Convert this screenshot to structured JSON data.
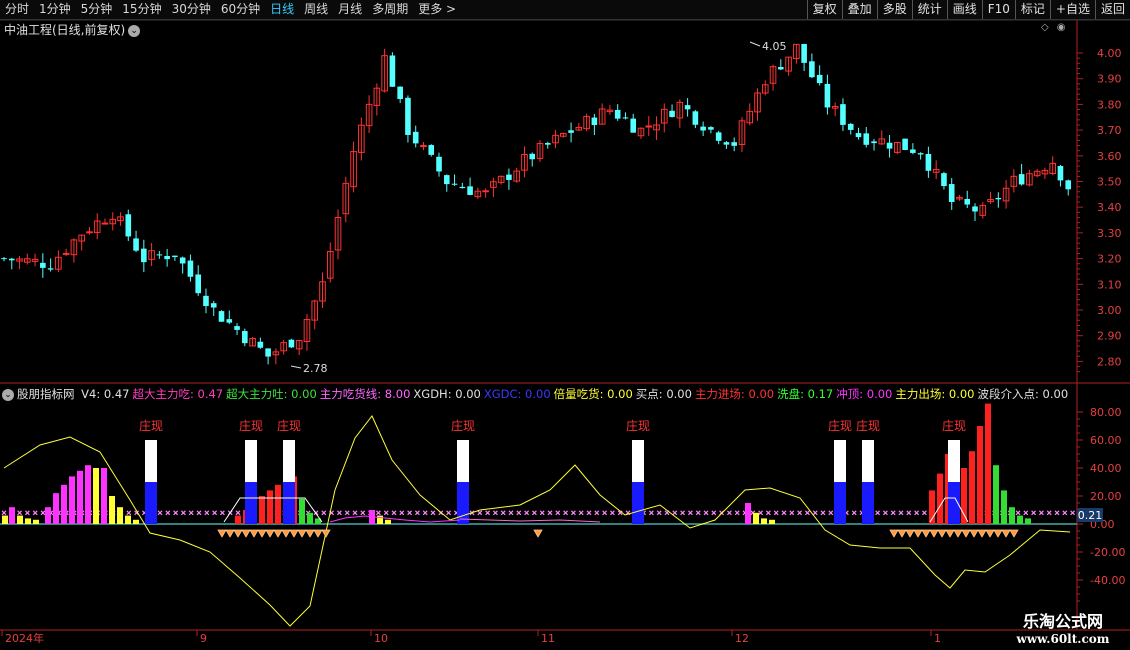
{
  "topbar": {
    "periods": [
      "分时",
      "1分钟",
      "5分钟",
      "15分钟",
      "30分钟",
      "60分钟",
      "日线",
      "周线",
      "月线",
      "多周期"
    ],
    "active_period": "日线",
    "more_label": "更多",
    "tools": [
      "复权",
      "叠加",
      "多股",
      "统计",
      "画线",
      "F10",
      "标记",
      "+自选",
      "返回"
    ]
  },
  "main_chart": {
    "title": "中油工程(日线,前复权)",
    "price_axis": [
      "4.00",
      "3.90",
      "3.80",
      "3.70",
      "3.60",
      "3.50",
      "3.40",
      "3.30",
      "3.20",
      "3.10",
      "3.00",
      "2.90",
      "2.80"
    ],
    "high_label": "4.05",
    "low_label": "2.78"
  },
  "indicator": {
    "name": "股朋指标网",
    "values": [
      {
        "text": "V4: 0.47",
        "color": "#e0e0e0"
      },
      {
        "text": "超大主力吃: 0.47",
        "color": "#ff3fbf"
      },
      {
        "text": "超大主力吐: 0.00",
        "color": "#3ce33c"
      },
      {
        "text": "主力吃货线: 8.00",
        "color": "#ff66ff"
      },
      {
        "text": "XGDH: 0.00",
        "color": "#e0e0e0"
      },
      {
        "text": "XGDC: 0.00",
        "color": "#3a3aff"
      },
      {
        "text": "倍量吃货: 0.00",
        "color": "#ffff33"
      },
      {
        "text": "买点: 0.00",
        "color": "#e0e0e0"
      },
      {
        "text": "主力进场: 0.00",
        "color": "#ff3333"
      },
      {
        "text": "洗盘: 0.17",
        "color": "#33ff33"
      },
      {
        "text": "冲顶: 0.00",
        "color": "#ff33ff"
      },
      {
        "text": "主力出场: 0.00",
        "color": "#ffff33"
      },
      {
        "text": "波段介入点: 0.00",
        "color": "#e0e0e0"
      }
    ],
    "axis": [
      "80.00",
      "60.00",
      "40.00",
      "20.00",
      "0.00",
      "-20.00",
      "-40.00"
    ],
    "current_value": "0.21",
    "zhuang_label": "庄现"
  },
  "time_axis": [
    "2024年",
    "9",
    "10",
    "11",
    "12",
    "1"
  ],
  "watermark": {
    "line1": "乐淘公式网",
    "line2": "www.60lt.com"
  },
  "colors": {
    "up": "#ff3232",
    "down": "#54ffff",
    "ma_yellow": "#ffff3a",
    "axis": "#b02020"
  }
}
